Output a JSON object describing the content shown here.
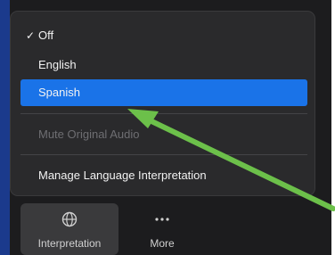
{
  "menu": {
    "items": [
      {
        "label": "Off",
        "checked": true
      },
      {
        "label": "English",
        "checked": false
      },
      {
        "label": "Spanish",
        "checked": false,
        "highlighted": true
      }
    ],
    "mute_label": "Mute Original Audio",
    "manage_label": "Manage Language Interpretation"
  },
  "toolbar": {
    "interpretation": {
      "label": "Interpretation",
      "icon": "globe-icon"
    },
    "more": {
      "label": "More",
      "icon": "ellipsis-icon"
    }
  },
  "colors": {
    "highlight": "#1a73e8",
    "annotation_arrow": "#6cc04a",
    "frame_edge": "#1b3a8c"
  }
}
